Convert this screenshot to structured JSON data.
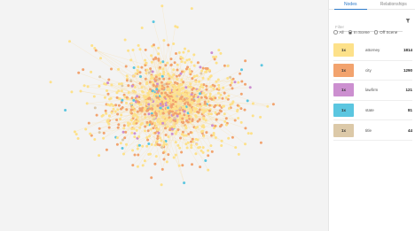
{
  "tabs": [
    {
      "label": "Nodes",
      "active": true
    },
    {
      "label": "Relationships",
      "active": false
    }
  ],
  "filter": {
    "placeholder": "Filter"
  },
  "scope": {
    "options": [
      {
        "label": "All",
        "selected": false
      },
      {
        "label": "In Scene",
        "selected": true
      },
      {
        "label": "Off Scene",
        "selected": false
      }
    ]
  },
  "node_types": [
    {
      "badge": "1x",
      "name": "attorney",
      "count": "1814",
      "color": "#fde18a"
    },
    {
      "badge": "1x",
      "name": "city",
      "count": "1290",
      "color": "#f2a36e"
    },
    {
      "badge": "1x",
      "name": "lawfirm",
      "count": "121",
      "color": "#cc8fd0"
    },
    {
      "badge": "1x",
      "name": "state",
      "count": "81",
      "color": "#5bc6e0"
    },
    {
      "badge": "1x",
      "name": "title",
      "count": "44",
      "color": "#dcc9a8"
    }
  ],
  "graph": {
    "background": "#f3f3f3",
    "edge_color": "#f7dda0"
  },
  "icons": {
    "filter": "filter-funnel-icon",
    "handle": "drag-handle-icon"
  }
}
